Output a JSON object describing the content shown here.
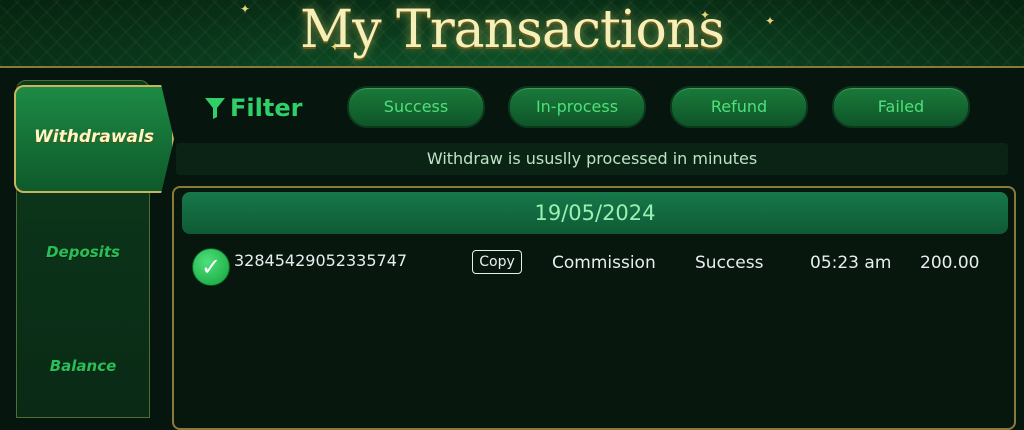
{
  "header": {
    "title": "My Transactions"
  },
  "sidebar": {
    "items": [
      {
        "label": "Withdrawals"
      },
      {
        "label": "Deposits"
      },
      {
        "label": "Balance"
      }
    ]
  },
  "filter": {
    "label": "Filter",
    "options": [
      "Success",
      "In-process",
      "Refund",
      "Failed"
    ]
  },
  "notice": "Withdraw is ususlly processed in minutes",
  "transactions": {
    "date": "19/05/2024",
    "rows": [
      {
        "id": "32845429052335747",
        "copy_label": "Copy",
        "type": "Commission",
        "status": "Success",
        "time": "05:23 am",
        "amount": "200.00"
      }
    ]
  },
  "colors": {
    "accent": "#2fd06a",
    "gold_border": "#8a7a3a",
    "background": "#06160f"
  }
}
